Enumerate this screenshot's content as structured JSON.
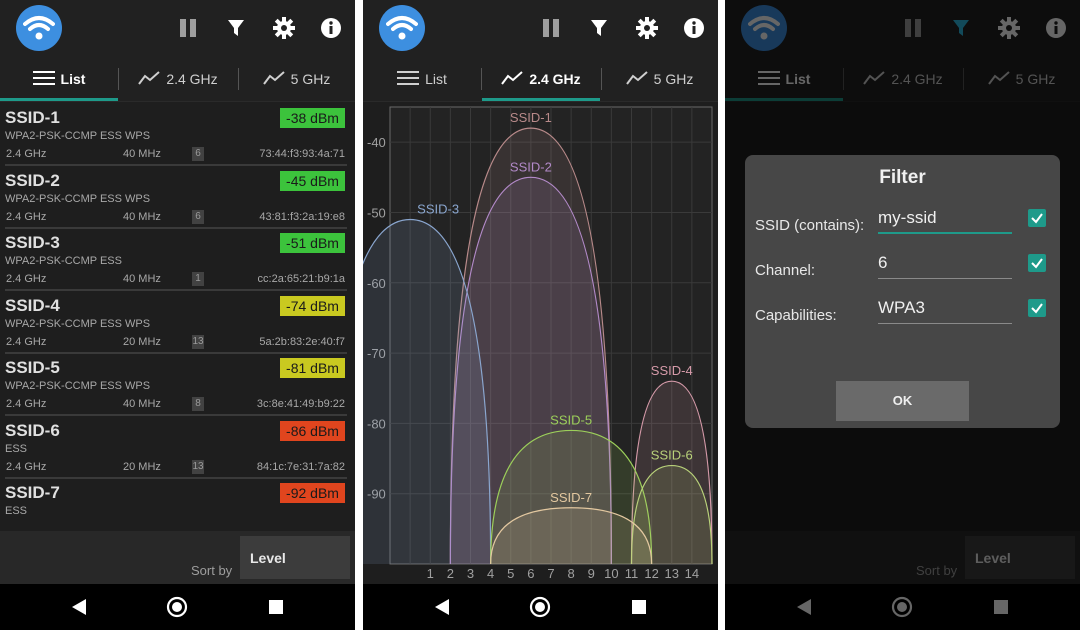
{
  "colors": {
    "accent": "#1e9a8a",
    "good": "#3cc33c",
    "ok": "#c9c920",
    "bad": "#e0451e",
    "logo": "#3d8fe0"
  },
  "appbar": {
    "logo_icon": "wifi-icon",
    "actions": [
      "pause-icon",
      "filter-icon",
      "gear-icon",
      "info-icon"
    ]
  },
  "tabs": [
    {
      "label": "List",
      "icon": "list-icon"
    },
    {
      "label": "2.4 GHz",
      "icon": "graph-icon"
    },
    {
      "label": "5 GHz",
      "icon": "graph-icon"
    }
  ],
  "access_points": [
    {
      "ssid": "SSID-1",
      "level": "-38 dBm",
      "level_class": "good",
      "caps": "WPA2-PSK-CCMP ESS WPS",
      "band": "2.4 GHz",
      "width": "40 MHz",
      "channel": "6",
      "mac": "73:44:f3:93:4a:71"
    },
    {
      "ssid": "SSID-2",
      "level": "-45 dBm",
      "level_class": "good",
      "caps": "WPA2-PSK-CCMP ESS WPS",
      "band": "2.4 GHz",
      "width": "40 MHz",
      "channel": "6",
      "mac": "43:81:f3:2a:19:e8"
    },
    {
      "ssid": "SSID-3",
      "level": "-51 dBm",
      "level_class": "good",
      "caps": "WPA2-PSK-CCMP ESS",
      "band": "2.4 GHz",
      "width": "40 MHz",
      "channel": "1",
      "mac": "cc:2a:65:21:b9:1a"
    },
    {
      "ssid": "SSID-4",
      "level": "-74 dBm",
      "level_class": "ok",
      "caps": "WPA2-PSK-CCMP ESS WPS",
      "band": "2.4 GHz",
      "width": "20 MHz",
      "channel": "13",
      "mac": "5a:2b:83:2e:40:f7"
    },
    {
      "ssid": "SSID-5",
      "level": "-81 dBm",
      "level_class": "ok",
      "caps": "WPA2-PSK-CCMP ESS WPS",
      "band": "2.4 GHz",
      "width": "40 MHz",
      "channel": "8",
      "mac": "3c:8e:41:49:b9:22"
    },
    {
      "ssid": "SSID-6",
      "level": "-86 dBm",
      "level_class": "bad",
      "caps": "ESS",
      "band": "2.4 GHz",
      "width": "20 MHz",
      "channel": "13",
      "mac": "84:1c:7e:31:7a:82"
    },
    {
      "ssid": "SSID-7",
      "level": "-92 dBm",
      "level_class": "bad",
      "caps": "ESS",
      "band": "",
      "width": "",
      "channel": "",
      "mac": ""
    }
  ],
  "sort": {
    "label": "Sort by",
    "value": "Level"
  },
  "navbar": [
    "back-icon",
    "home-icon",
    "recent-apps-icon"
  ],
  "chart_data": {
    "type": "area",
    "y_ticks": [
      "-40",
      "-50",
      "-60",
      "-70",
      "-80",
      "-90"
    ],
    "x_ticks": [
      "1",
      "2",
      "3",
      "4",
      "5",
      "6",
      "7",
      "8",
      "9",
      "10",
      "11",
      "12",
      "13",
      "14"
    ],
    "ylim": [
      -100,
      -35
    ],
    "xlim": [
      -1,
      15
    ],
    "series": [
      {
        "name": "SSID-1",
        "channel": 6,
        "half_width": 4,
        "level": -38,
        "color": "#b88a8a"
      },
      {
        "name": "SSID-2",
        "channel": 6,
        "half_width": 4,
        "level": -45,
        "color": "#b38ac9"
      },
      {
        "name": "SSID-3",
        "channel": 0,
        "half_width": 4,
        "level": -51,
        "color": "#8aa6cf"
      },
      {
        "name": "SSID-4",
        "channel": 13,
        "half_width": 2,
        "level": -74,
        "color": "#d59aa9"
      },
      {
        "name": "SSID-5",
        "channel": 8,
        "half_width": 4,
        "level": -81,
        "color": "#9ccf5a"
      },
      {
        "name": "SSID-6",
        "channel": 13,
        "half_width": 2,
        "level": -86,
        "color": "#b9d27a"
      },
      {
        "name": "SSID-7",
        "channel": 8,
        "half_width": 4,
        "level": -92,
        "color": "#e3c8a0"
      }
    ]
  },
  "filter_dialog": {
    "title": "Filter",
    "fields": [
      {
        "label": "SSID (contains):",
        "value": "my-ssid",
        "checked": true
      },
      {
        "label": "Channel:",
        "value": "6",
        "checked": true
      },
      {
        "label": "Capabilities:",
        "value": "WPA3",
        "checked": true
      }
    ],
    "ok_label": "OK"
  }
}
